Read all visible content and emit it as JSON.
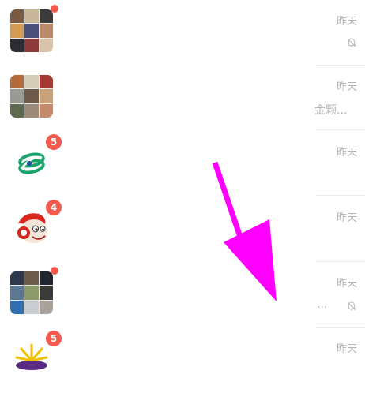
{
  "chats": [
    {
      "time": "昨天",
      "badge": "",
      "has_dot": true,
      "preview": "",
      "muted": true,
      "avatar": "group-photo-grid"
    },
    {
      "time": "昨天",
      "badge": "",
      "has_dot": false,
      "preview": "金颗...",
      "muted": false,
      "avatar": "group-photo-grid"
    },
    {
      "time": "昨天",
      "badge": "5",
      "has_dot": false,
      "preview": "",
      "muted": false,
      "avatar": "bank-logo"
    },
    {
      "time": "昨天",
      "badge": "4",
      "has_dot": false,
      "preview": "",
      "muted": false,
      "avatar": "mascot-logo"
    },
    {
      "time": "昨天",
      "badge": "",
      "has_dot": true,
      "preview": "...",
      "muted": true,
      "avatar": "group-photo-grid"
    },
    {
      "time": "昨天",
      "badge": "5",
      "has_dot": false,
      "preview": "",
      "muted": false,
      "avatar": "sun-logo"
    }
  ],
  "colors": {
    "badge": "#f45a4e",
    "arrow": "#ff00ff",
    "bank_logo": "#1aa36c",
    "bank_logo_accent": "#1f4fa0",
    "mascot_red": "#d8251d"
  },
  "overlay": {
    "icon": "arrow-down-icon"
  }
}
